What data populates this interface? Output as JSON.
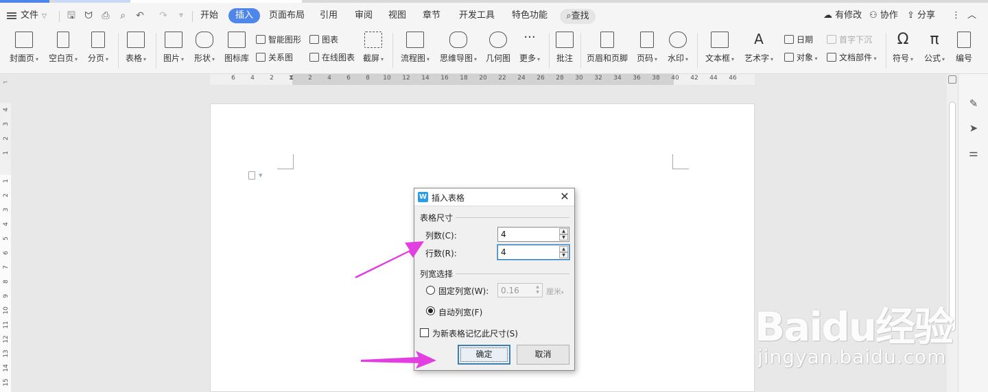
{
  "menubar": {
    "file_label": "文件",
    "tabs": [
      "开始",
      "插入",
      "页面布局",
      "引用",
      "审阅",
      "视图",
      "章节",
      "开发工具",
      "特色功能"
    ],
    "active_tab": "插入",
    "search_label": "查找",
    "right": [
      "有修改",
      "协作",
      "分享"
    ]
  },
  "ribbon": {
    "cover": "封面页",
    "blank": "空白页",
    "pagebreak": "分页",
    "table": "表格",
    "picture": "图片",
    "shape": "形状",
    "iconlib": "图标库",
    "smartart": "智能图形",
    "chart": "图表",
    "relation": "关系图",
    "online_chart": "在线图表",
    "screenshot": "截屏",
    "flowchart": "流程图",
    "mindmap": "思维导图",
    "geometry": "几何图",
    "more": "更多",
    "comment": "批注",
    "header_footer": "页眉和页脚",
    "page_number": "页码",
    "watermark": "水印",
    "textbox": "文本框",
    "wordart": "艺术字",
    "date": "日期",
    "dropcap": "首字下沉",
    "object": "对象",
    "docparts": "文档部件",
    "symbol": "符号",
    "formula": "公式",
    "numbering": "编号"
  },
  "hruler": [
    "6",
    "4",
    "2",
    "2",
    "4",
    "6",
    "8",
    "10",
    "12",
    "14",
    "16",
    "18",
    "20",
    "22",
    "24",
    "26",
    "28",
    "30",
    "32",
    "34",
    "36",
    "38",
    "40",
    "42",
    "44",
    "46"
  ],
  "vruler": [
    "4",
    "3",
    "2",
    "1",
    "1",
    "2",
    "3",
    "4",
    "5",
    "6",
    "7",
    "8",
    "9",
    "10",
    "11",
    "12",
    "13",
    "14",
    "15"
  ],
  "dialog": {
    "title": "插入表格",
    "size_group": "表格尺寸",
    "columns_label": "列数(C):",
    "columns_value": "4",
    "rows_label": "行数(R):",
    "rows_value": "4",
    "width_group": "列宽选择",
    "fixed_label": "固定列宽(W):",
    "fixed_value": "0.16",
    "unit": "厘米",
    "auto_label": "自动列宽(F)",
    "remember_label": "为新表格记忆此尺寸(S)",
    "ok": "确定",
    "cancel": "取消"
  },
  "watermark": {
    "brand": "Baidu经验",
    "url": "jingyan.baidu.com"
  },
  "colors": {
    "accent": "#4f86ec",
    "arrow": "#e23ee0"
  }
}
